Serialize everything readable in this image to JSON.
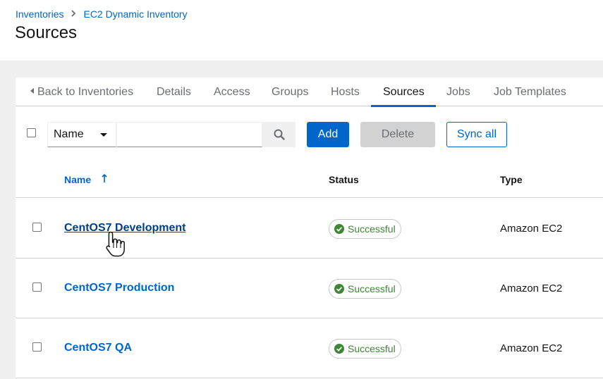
{
  "breadcrumb": {
    "items": [
      {
        "label": "Inventories"
      },
      {
        "label": "EC2 Dynamic Inventory"
      }
    ]
  },
  "page": {
    "title": "Sources"
  },
  "tabs": [
    {
      "label": "Back to Inventories",
      "icon": "caret-left-icon"
    },
    {
      "label": "Details"
    },
    {
      "label": "Access"
    },
    {
      "label": "Groups"
    },
    {
      "label": "Hosts"
    },
    {
      "label": "Sources",
      "active": true
    },
    {
      "label": "Jobs"
    },
    {
      "label": "Job Templates"
    }
  ],
  "toolbar": {
    "filter_select": "Name",
    "search_placeholder": "",
    "add_label": "Add",
    "delete_label": "Delete",
    "sync_label": "Sync all"
  },
  "table": {
    "columns": [
      "Name",
      "Status",
      "Type"
    ],
    "sort": "ascending",
    "rows": [
      {
        "name": "CentOS7 Development",
        "status": "Successful",
        "type": "Amazon EC2"
      },
      {
        "name": "CentOS7 Production",
        "status": "Successful",
        "type": "Amazon EC2"
      },
      {
        "name": "CentOS7 QA",
        "status": "Successful",
        "type": "Amazon EC2"
      }
    ]
  },
  "colors": {
    "link": "#0066cc",
    "success": "#3e8635",
    "disabled": "#d2d2d2"
  }
}
